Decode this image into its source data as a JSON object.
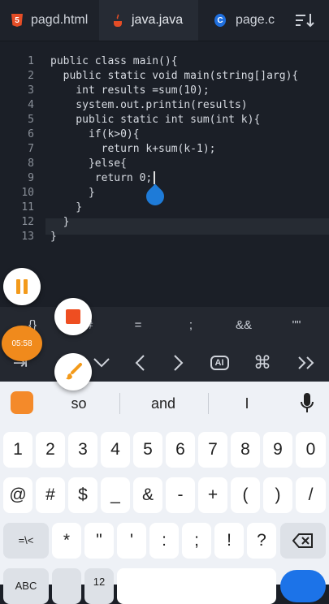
{
  "tabs": [
    {
      "label": "pagd.html",
      "icon": "html5-icon",
      "icon_glyph": "5"
    },
    {
      "label": "java.java",
      "icon": "java-icon"
    },
    {
      "label": "page.c",
      "icon": "c-icon",
      "icon_glyph": "C"
    }
  ],
  "code": {
    "line_numbers": [
      "1",
      "2",
      "3",
      "4",
      "5",
      "6",
      "7",
      "8",
      "9",
      "10",
      "11",
      "12",
      "13"
    ],
    "lines": [
      "public class main(){",
      "  public static void main(string[]arg){",
      "    int results =sum(10);",
      "    system.out.printin(results)",
      "    public static int sum(int k){",
      "      if(k>0){",
      "        return k+sum(k-1);",
      "      }else{",
      "       return 0;",
      "      }",
      "    }",
      "  }",
      "}"
    ]
  },
  "recorder": {
    "timer": "05:58"
  },
  "symbols": [
    "{}",
    "#",
    "=",
    ";",
    "&&",
    "\"\""
  ],
  "suggestions": [
    "so",
    "and",
    "I"
  ],
  "keys": {
    "numbers": [
      "1",
      "2",
      "3",
      "4",
      "5",
      "6",
      "7",
      "8",
      "9",
      "0"
    ],
    "symbols1": [
      "@",
      "#",
      "$",
      "_",
      "&",
      "-",
      "+",
      "(",
      ")",
      "/"
    ],
    "row3": [
      "=\\<",
      "*",
      "\"",
      "'",
      ":",
      ";",
      "!",
      "?"
    ],
    "row4": [
      "ABC",
      "12"
    ]
  },
  "colors": {
    "accent": "#1c73e8",
    "recorder": "#f08a1c"
  }
}
